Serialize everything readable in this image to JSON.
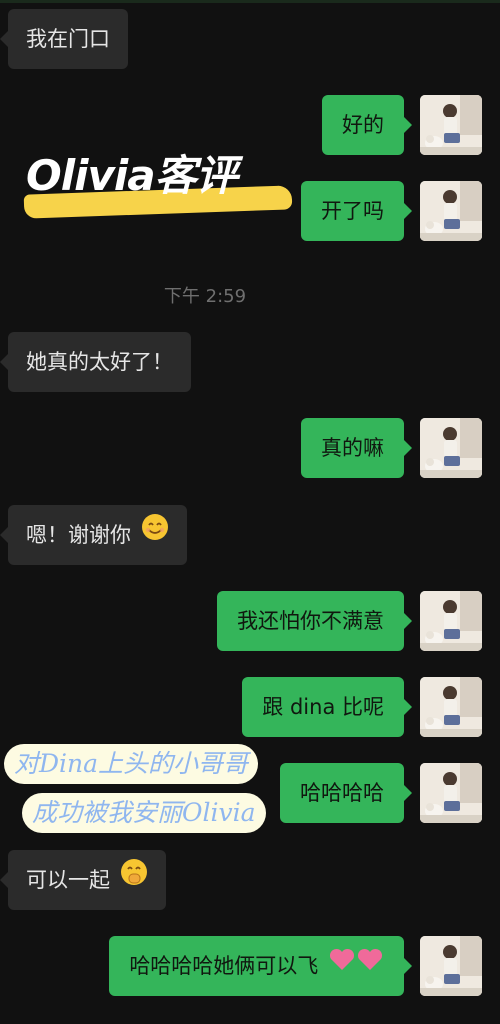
{
  "title_sticker": {
    "text": "Olivia客评"
  },
  "timestamp": "下午 2:59",
  "messages": [
    {
      "side": "in",
      "text": "我在门口",
      "emoji": ""
    },
    {
      "side": "out",
      "text": "好的",
      "emoji": ""
    },
    {
      "side": "out",
      "text": "开了吗",
      "emoji": ""
    },
    {
      "side": "in",
      "text": "她真的太好了！",
      "emoji": ""
    },
    {
      "side": "out",
      "text": "真的嘛",
      "emoji": ""
    },
    {
      "side": "in",
      "text": "嗯！谢谢你",
      "emoji": "smiling-face-icon"
    },
    {
      "side": "out",
      "text": "我还怕你不满意",
      "emoji": ""
    },
    {
      "side": "out",
      "text": "跟 dina 比呢",
      "emoji": ""
    },
    {
      "side": "out",
      "text": "哈哈哈哈",
      "emoji": ""
    },
    {
      "side": "in",
      "text": "可以一起",
      "emoji": "giggle-face-icon"
    },
    {
      "side": "out",
      "text": "哈哈哈哈她俩可以飞",
      "emoji": "pink-hearts-icon"
    }
  ],
  "caption_sticker": {
    "line1": "对Dina上头的小哥哥",
    "line2": "成功被我安丽Olivia"
  },
  "colors": {
    "background": "#111111",
    "incoming_bubble": "#2b2b2b",
    "outgoing_bubble": "#34b55a",
    "highlight": "#f7d34a",
    "caption_text": "#8fb6ef",
    "caption_bg": "#fdfbe2"
  }
}
